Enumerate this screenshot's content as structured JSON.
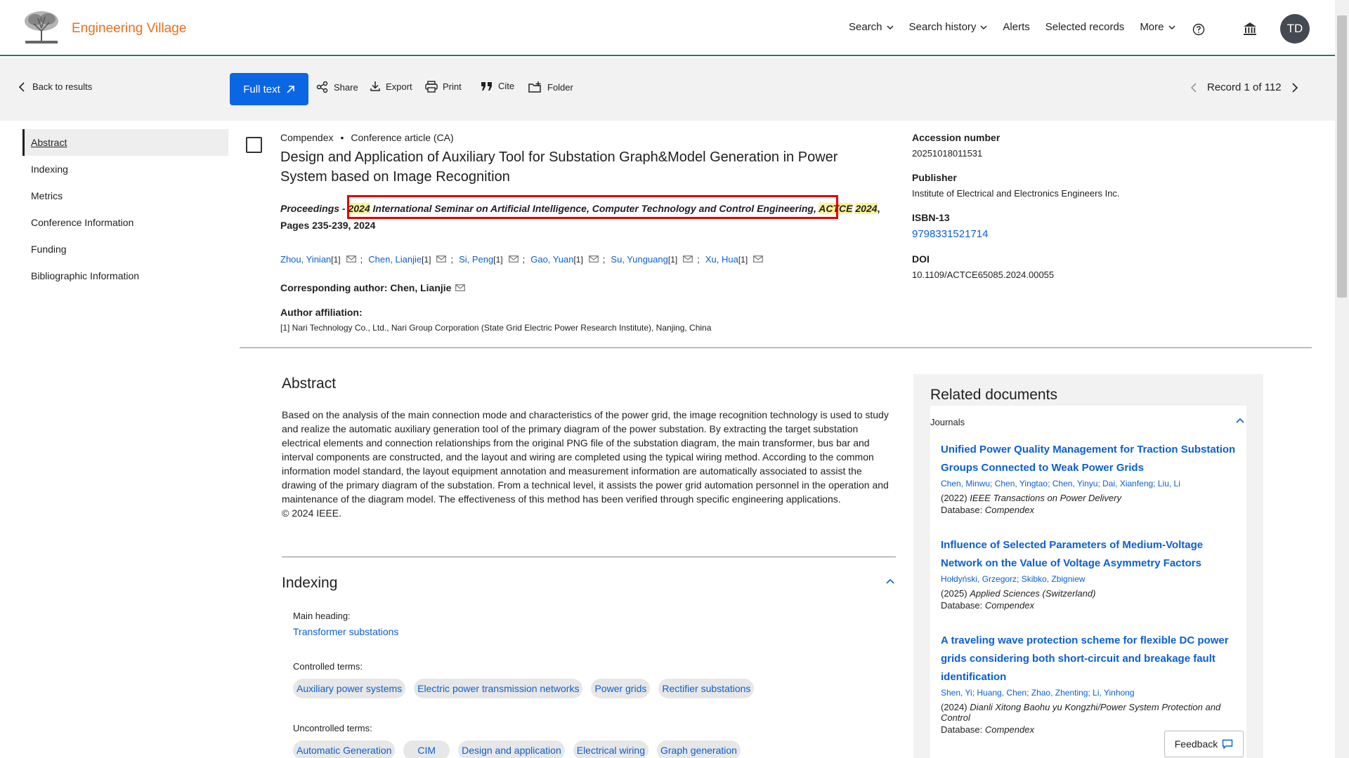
{
  "brand": {
    "name": "Engineering Village"
  },
  "topnav": {
    "search": "Search",
    "search_history": "Search history",
    "alerts": "Alerts",
    "selected_records": "Selected records",
    "more": "More",
    "avatar": "TD"
  },
  "toolbar": {
    "back": "Back to results",
    "full_text": "Full text",
    "share": "Share",
    "export": "Export",
    "print": "Print",
    "cite": "Cite",
    "folder": "Folder",
    "record": "Record 1 of 112"
  },
  "leftnav": [
    "Abstract",
    "Indexing",
    "Metrics",
    "Conference Information",
    "Funding",
    "Bibliographic Information"
  ],
  "record": {
    "database": "Compendex",
    "bullet": "•",
    "doc_type": "Conference article (CA)",
    "title": "Design and Application of Auxiliary Tool for Substation Graph&Model Generation in Power System based on Image Recognition",
    "proc_prefix": "Proceedings - ",
    "proc_year": "2024",
    "proc_name": " International Seminar on Artificial Intelligence, Computer Technology and Control Engineering, ",
    "proc_acr1": "ACTCE",
    "proc_acr2": "2024",
    "proc_pages": ", Pages 235-239, 2024",
    "authors": [
      {
        "name": "Zhou, Yinian",
        "sup": "[1]"
      },
      {
        "name": "Chen, Lianjie",
        "sup": "[1]"
      },
      {
        "name": "Si, Peng",
        "sup": "[1]"
      },
      {
        "name": "Gao, Yuan",
        "sup": "[1]"
      },
      {
        "name": "Su, Yunguang",
        "sup": "[1]"
      },
      {
        "name": "Xu, Hua",
        "sup": "[1]"
      }
    ],
    "author_sep": ";",
    "corresponding": "Corresponding author: Chen, Lianjie",
    "affiliation_label": "Author affiliation:",
    "affiliation": "[1] Nari Technology Co., Ltd., Nari Group Corporation (State Grid Electric Power Research Institute), Nanjing, China"
  },
  "meta": {
    "accession_label": "Accession number",
    "accession": "20251018011531",
    "publisher_label": "Publisher",
    "publisher": "Institute of Electrical and Electronics Engineers Inc.",
    "isbn_label": "ISBN-13",
    "isbn": "9798331521714",
    "doi_label": "DOI",
    "doi": "10.1109/ACTCE65085.2024.00055"
  },
  "abstract": {
    "heading": "Abstract",
    "text": "Based on the analysis of the main connection mode and characteristics of the power grid, the image recognition technology is used to study and realize the automatic auxiliary generation tool of the primary diagram of the power substation. By extracting the target substation electrical elements and connection relationships from the original PNG file of the substation diagram, the main transformer, bus bar and interval components are constructed, and the layout and wiring are completed using the typical wiring method. According to the common information model standard, the layout equipment annotation and measurement information are automatically associated to assist the drawing of the primary diagram of the substation. From a technical level, it assists the power grid automation personnel in the operation and maintenance of the diagram model. The effectiveness of this method has been verified through specific engineering applications.",
    "copyright": "© 2024 IEEE."
  },
  "indexing": {
    "heading": "Indexing",
    "main_heading_label": "Main heading:",
    "main_heading": "Transformer substations",
    "controlled_label": "Controlled terms:",
    "controlled": [
      "Auxiliary power systems",
      "Electric power transmission networks",
      "Power grids",
      "Rectifier substations"
    ],
    "uncontrolled_label": "Uncontrolled terms:",
    "uncontrolled": [
      "Automatic Generation",
      "CIM",
      "Design and application",
      "Electrical wiring",
      "Graph generation"
    ]
  },
  "related": {
    "heading": "Related documents",
    "journals_label": "Journals",
    "docs": [
      {
        "title": "Unified Power Quality Management for Traction Substation Groups Connected to Weak Power Grids",
        "authors": "Chen, Minwu;  Chen, Yingtao;  Chen, Yinyu;  Dai, Xianfeng;      Liu, Li",
        "year": "(2022) ",
        "journal": "IEEE Transactions on Power Delivery",
        "db_label": "Database: ",
        "db": "Compendex"
      },
      {
        "title": "Influence of Selected Parameters of Medium-Voltage Network on the Value of Voltage Asymmetry Factors",
        "authors": "Hołdyński, Grzegorz;  Skibko, Zbigniew",
        "year": "(2025) ",
        "journal": "Applied Sciences (Switzerland)",
        "db_label": "Database: ",
        "db": "Compendex"
      },
      {
        "title": "A traveling wave protection scheme for flexible DC power grids considering both short-circuit and breakage fault identification",
        "authors": "Shen, Yi;   Huang, Chen;  Zhao, Zhenting;  Li, Yinhong",
        "year": "(2024) ",
        "journal": "Dianli Xitong Baohu yu Kongzhi/Power System Protection and Control",
        "db_label": "Database: ",
        "db": "Compendex"
      }
    ]
  },
  "feedback": "Feedback"
}
